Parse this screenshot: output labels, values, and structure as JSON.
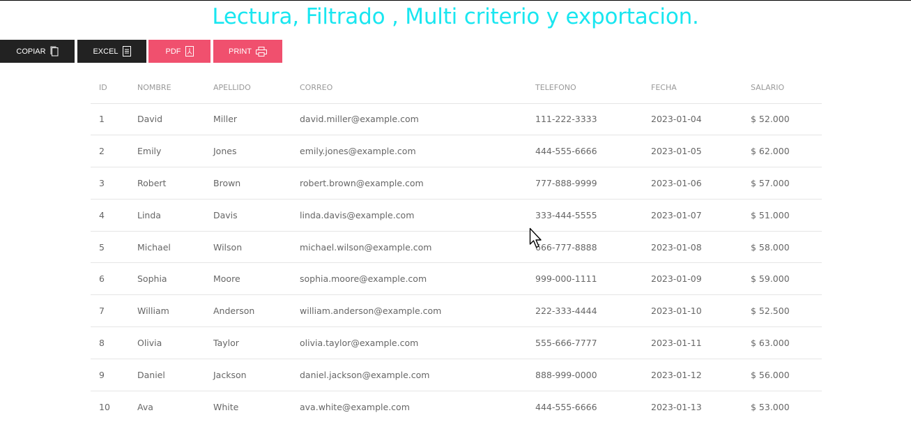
{
  "page": {
    "title": "Lectura, Filtrado , Multi criterio y exportacion."
  },
  "colors": {
    "title": "#19e6f0",
    "button_dark": "#222222",
    "button_pink": "#f0506e",
    "row_border": "#e5e5e5",
    "text": "#666666",
    "header_text": "#999999"
  },
  "toolbar": {
    "buttons": [
      {
        "label": "COPIAR",
        "icon": "copy-icon"
      },
      {
        "label": "EXCEL",
        "icon": "file-text-icon"
      },
      {
        "label": "PDF",
        "icon": "file-pdf-icon"
      },
      {
        "label": "PRINT",
        "icon": "print-icon"
      }
    ]
  },
  "table": {
    "columns": [
      "ID",
      "NOMBRE",
      "APELLIDO",
      "CORREO",
      "TELEFONO",
      "FECHA",
      "SALARIO"
    ],
    "rows": [
      [
        "1",
        "David",
        "Miller",
        "david.miller@example.com",
        "111-222-3333",
        "2023-01-04",
        "$ 52.000"
      ],
      [
        "2",
        "Emily",
        "Jones",
        "emily.jones@example.com",
        "444-555-6666",
        "2023-01-05",
        "$ 62.000"
      ],
      [
        "3",
        "Robert",
        "Brown",
        "robert.brown@example.com",
        "777-888-9999",
        "2023-01-06",
        "$ 57.000"
      ],
      [
        "4",
        "Linda",
        "Davis",
        "linda.davis@example.com",
        "333-444-5555",
        "2023-01-07",
        "$ 51.000"
      ],
      [
        "5",
        "Michael",
        "Wilson",
        "michael.wilson@example.com",
        "666-777-8888",
        "2023-01-08",
        "$ 58.000"
      ],
      [
        "6",
        "Sophia",
        "Moore",
        "sophia.moore@example.com",
        "999-000-1111",
        "2023-01-09",
        "$ 59.000"
      ],
      [
        "7",
        "William",
        "Anderson",
        "william.anderson@example.com",
        "222-333-4444",
        "2023-01-10",
        "$ 52.500"
      ],
      [
        "8",
        "Olivia",
        "Taylor",
        "olivia.taylor@example.com",
        "555-666-7777",
        "2023-01-11",
        "$ 63.000"
      ],
      [
        "9",
        "Daniel",
        "Jackson",
        "daniel.jackson@example.com",
        "888-999-0000",
        "2023-01-12",
        "$ 56.000"
      ],
      [
        "10",
        "Ava",
        "White",
        "ava.white@example.com",
        "444-555-6666",
        "2023-01-13",
        "$ 53.000"
      ]
    ]
  }
}
